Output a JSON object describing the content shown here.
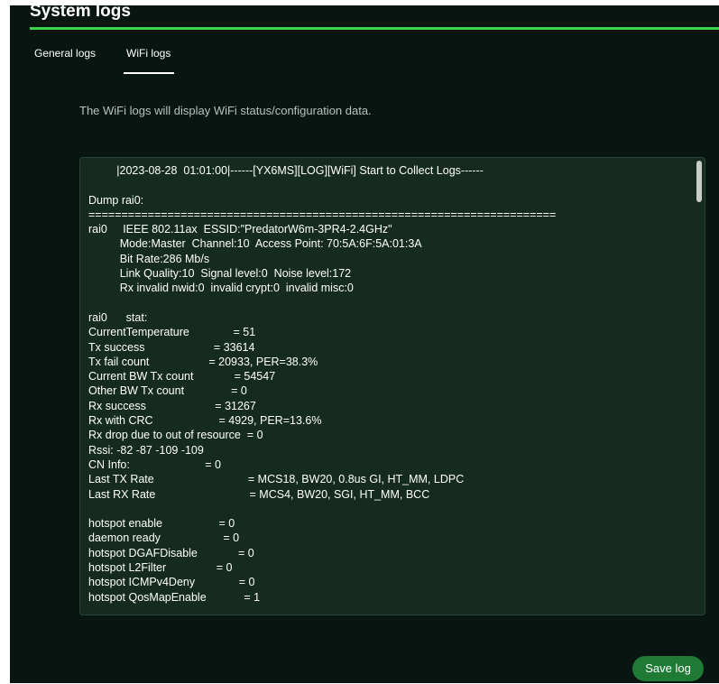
{
  "header": {
    "title": "System logs"
  },
  "tabs": [
    {
      "label": "General logs"
    },
    {
      "label": "WiFi logs"
    }
  ],
  "description": "The WiFi logs will display WiFi status/configuration data.",
  "log": {
    "content": "         |2023-08-28  01:01:00|------[YX6MS][LOG][WiFi] Start to Collect Logs------\n\nDump rai0:\n=======================================================================\nrai0     IEEE 802.11ax  ESSID:\"PredatorW6m-3PR4-2.4GHz\"\n          Mode:Master  Channel:10  Access Point: 70:5A:6F:5A:01:3A\n          Bit Rate:286 Mb/s\n          Link Quality:10  Signal level:0  Noise level:172\n          Rx invalid nwid:0  invalid crypt:0  invalid misc:0\n\nrai0      stat:\nCurrentTemperature              = 51\nTx success                      = 33614\nTx fail count                   = 20933, PER=38.3%\nCurrent BW Tx count             = 54547\nOther BW Tx count               = 0\nRx success                      = 31267\nRx with CRC                     = 4929, PER=13.6%\nRx drop due to out of resource  = 0\nRssi: -82 -87 -109 -109\nCN Info:                        = 0\nLast TX Rate                              = MCS18, BW20, 0.8us GI, HT_MM, LDPC\nLast RX Rate                              = MCS4, BW20, SGI, HT_MM, BCC\n\nhotspot enable                  = 0\ndaemon ready                    = 0\nhotspot DGAFDisable             = 0\nhotspot L2Filter                = 0\nhotspot ICMPv4Deny              = 0\nhotspot QosMapEnable            = 1"
  },
  "actions": {
    "save_label": "Save log"
  },
  "colors": {
    "accent": "#3fd24b",
    "button": "#1f7a35",
    "background": "#081510"
  }
}
